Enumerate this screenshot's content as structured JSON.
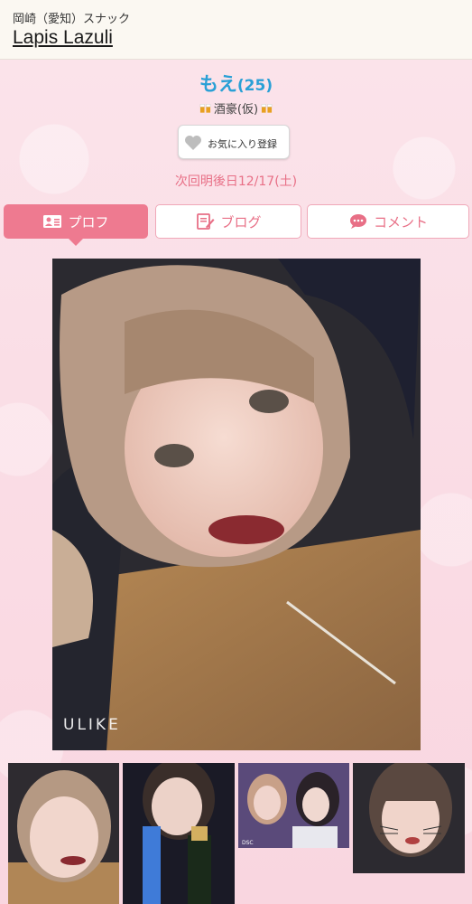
{
  "header": {
    "area": "岡崎（愛知）スナック",
    "shop_name": "Lapis Lazuli"
  },
  "profile": {
    "name": "もえ",
    "age": "(25)",
    "tag": "酒豪(仮)",
    "tag_icon": "beer-icon",
    "favorite_label": "お気に入り登録",
    "favorite_icon": "heart-icon",
    "next_shift": "次回明後日12/17(土)"
  },
  "tabs": [
    {
      "label": "プロフ",
      "icon": "profile-card-icon",
      "active": true
    },
    {
      "label": "ブログ",
      "icon": "edit-note-icon",
      "active": false
    },
    {
      "label": "コメント",
      "icon": "speech-bubble-icon",
      "active": false
    }
  ],
  "photo": {
    "watermark": "ULIKE"
  },
  "thumbnails": {
    "third_caption": "DSC"
  },
  "colors": {
    "accent_pink": "#ee7a90",
    "name_blue": "#2aa0d6",
    "header_bg": "#fbf8f2"
  }
}
